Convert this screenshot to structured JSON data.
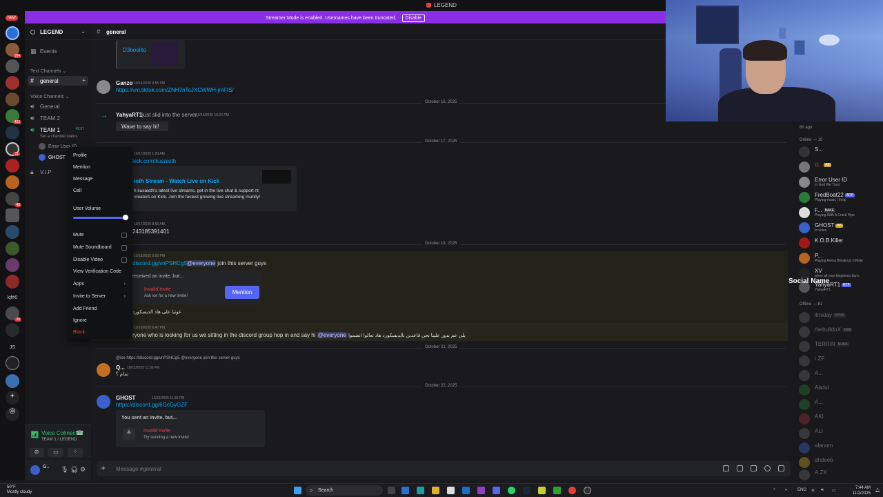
{
  "window": {
    "title": "LEGEND"
  },
  "banner": {
    "text": "Streamer Mode is enabled. Usernames have been truncated.",
    "disable_label": "Disable"
  },
  "rail": {
    "new_label": "NEW",
    "badges": [
      "164",
      "402",
      "31",
      "48",
      "30"
    ],
    "text_labels": [
      "kjf#0",
      "JS"
    ]
  },
  "server": {
    "name": "LEGEND",
    "events_label": "Events"
  },
  "channels": {
    "text_category": "Text Channels",
    "text": [
      {
        "name": "general"
      }
    ],
    "voice_category": "Voice Channels",
    "voice": [
      {
        "name": "General"
      },
      {
        "name": "TEAM 2"
      },
      {
        "name": "TEAM 1",
        "live_time": "42:57",
        "status_hint": "Set a channel status"
      },
      {
        "name": "V.I.P"
      }
    ],
    "voice_users": [
      "Error User ID",
      "GHOST"
    ]
  },
  "voice_connected": {
    "status": "Voice Connected",
    "channel": "TEAM 1 / LEGEND"
  },
  "user_panel": {
    "name": "G.."
  },
  "chat": {
    "channel": "general",
    "placeholder": "Message #general",
    "embed_title_top": "D3boolito",
    "messages": [
      {
        "author": "Ganzo",
        "time": "10/14/2025 9:55 PM",
        "link": "https://vm.tiktok.com/ZNH7nToJXCWWH-jmFtS/"
      },
      {
        "system": "just slid into the server.",
        "author": "YahyaRT1",
        "time": "10/16/2025 10:24 PM",
        "wave": "Wave to say hi!"
      },
      {
        "time": "10/17/2025 1:20 AM",
        "link": "kick.com/kusaioth",
        "embed_title": "ioth Stream - Watch Live on Kick",
        "embed_desc": "h kusaioth's latest live streams, get in the live chat & support nt creators on Kick. Join the fastest growing live streaming munity!"
      },
      {
        "time": "10/17/2025 8:53 AM",
        "text": "243185391401"
      },
      {
        "time": "10/18/2025 5:56 PM",
        "link": "discord.gg/vnPSHCg5",
        "mention": "@everyone",
        "tail": "join this server guys",
        "invite_head": "received an invite, but...",
        "invite_invalid": "Invalid Invite",
        "invite_hint": "Ask ice for a new invite!",
        "button": "Mention"
      },
      {
        "text": "غوثيا على هاد الديسكورد"
      },
      {
        "time": "10/18/2025 6:47 PM",
        "text": "ryone who is looking for us we sitting in the discord group hop in and say hi",
        "mention": "@everyone",
        "arabic": "يلي عم يدور علينا نحن قاعدين بالديسكورد هاد تعالوا انضموا"
      },
      {
        "author": "Q...",
        "time": "10/21/2025 11:36 PM",
        "reply": "@ice https://discord.gg/vnPSHCg5 @everyone join this server guys",
        "text": "تمام ؟"
      },
      {
        "author": "GHOST",
        "time": "10/22/2025 11:33 PM",
        "link": "https://discord.gg/6GcGyGZF",
        "invite_head": "You sent an invite, but...",
        "invite_invalid": "Invalid Invite",
        "invite_hint": "Try sending a new invite!"
      }
    ],
    "dates": [
      "October 16, 2025",
      "October 17, 2025",
      "October 18, 2025",
      "October 21, 2025",
      "October 22, 2025"
    ]
  },
  "context_menu": {
    "items": [
      "Profile",
      "Mention",
      "Message",
      "Call"
    ],
    "volume_label": "User Volume",
    "volume_level": 1.0,
    "toggles": [
      "Mute",
      "Mute Soundboard",
      "Disable Video"
    ],
    "more": [
      "View Verification Code",
      "Apps",
      "Invite to Server",
      "Add Friend",
      "Ignore"
    ],
    "danger": "Block"
  },
  "members": {
    "top_status": "8h ago",
    "online_header": "Online — 10",
    "online": [
      {
        "name": "S..."
      },
      {
        "name": "d...",
        "tag": "AB"
      },
      {
        "name": "Error User ID",
        "status": "In God We Trust"
      },
      {
        "name": "FredBoat22",
        "tag": "APP",
        "status": "Playing music | /help"
      },
      {
        "name": "F...",
        "tag": "BAKE",
        "status": "Playing With A Crack Pipe"
      },
      {
        "name": "GHOST",
        "tag": "AB",
        "status": "In voice"
      },
      {
        "name": "K.O.B.Killer"
      },
      {
        "name": "P...",
        "status": "Playing Arena Breakout: Infinite"
      },
      {
        "name": "XV",
        "status": "when all your kingdoms burn,"
      },
      {
        "name": "YahyaRT1",
        "tag": "RTF",
        "status": "YahyaRT1"
      }
    ],
    "offline_header": "Offline — 81",
    "offline": [
      {
        "name": "ilmiday",
        "tag": "SYNX"
      },
      {
        "name": "thebulldoX",
        "tag": "JGM"
      },
      {
        "name": "TERRIN",
        "tag": "NUNK"
      },
      {
        "name": "\\ ZF"
      },
      {
        "name": "A..."
      },
      {
        "name": "Abdul"
      },
      {
        "name": "A..."
      },
      {
        "name": "AKI"
      },
      {
        "name": "ALI"
      },
      {
        "name": "alanom"
      },
      {
        "name": "ahdeeb"
      },
      {
        "name": "A.ZX"
      }
    ],
    "overlay_label": "Social Name"
  },
  "taskbar": {
    "weather_temp": "50°F",
    "weather_desc": "Mostly cloudy",
    "search": "Search",
    "lang": "ENG",
    "time": "7:44 AM",
    "date": "11/2/2025"
  }
}
